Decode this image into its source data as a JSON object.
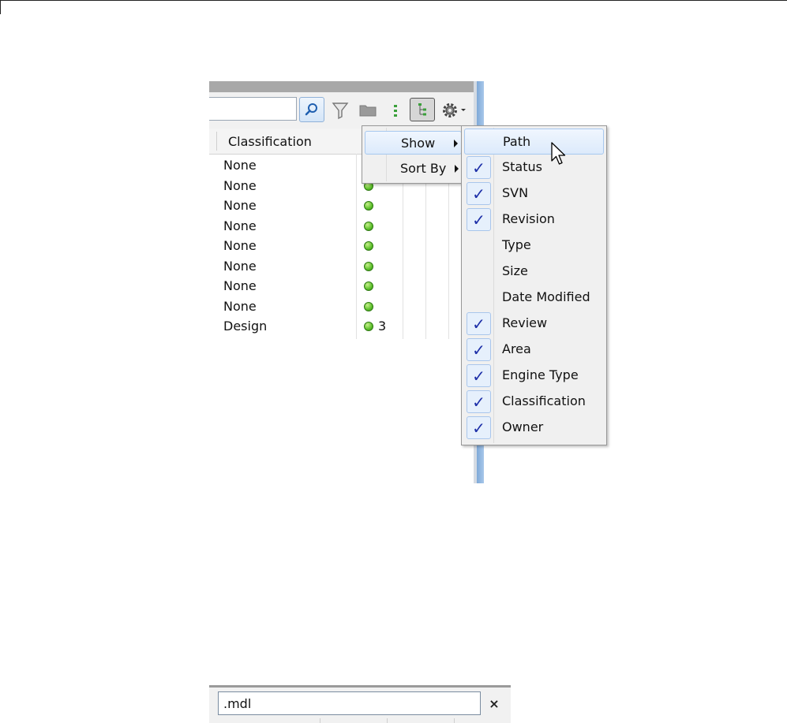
{
  "column_header": "Classification",
  "rows": [
    {
      "classification": "None",
      "status_count": ""
    },
    {
      "classification": "None",
      "status_count": ""
    },
    {
      "classification": "None",
      "status_count": ""
    },
    {
      "classification": "None",
      "status_count": ""
    },
    {
      "classification": "None",
      "status_count": ""
    },
    {
      "classification": "None",
      "status_count": ""
    },
    {
      "classification": "None",
      "status_count": ""
    },
    {
      "classification": "None",
      "status_count": ""
    },
    {
      "classification": "Design",
      "status_count": "3"
    }
  ],
  "context_menu": {
    "items": [
      {
        "label": "Show",
        "has_submenu": true,
        "active": true
      },
      {
        "label": "Sort By",
        "has_submenu": true,
        "active": false
      }
    ]
  },
  "show_submenu": {
    "items": [
      {
        "label": "Path",
        "checked": false,
        "hovered": true
      },
      {
        "label": "Status",
        "checked": true
      },
      {
        "label": "SVN",
        "checked": true
      },
      {
        "label": "Revision",
        "checked": true
      },
      {
        "label": "Type",
        "checked": false
      },
      {
        "label": "Size",
        "checked": false
      },
      {
        "label": "Date Modified",
        "checked": false
      },
      {
        "label": "Review",
        "checked": true
      },
      {
        "label": "Area",
        "checked": true
      },
      {
        "label": "Engine Type",
        "checked": true
      },
      {
        "label": "Classification",
        "checked": true
      },
      {
        "label": "Owner",
        "checked": true
      }
    ]
  },
  "check_glyph": "✓",
  "filter": {
    "value": ".mdl",
    "clear_label": "×"
  },
  "colors": {
    "status_ok": "#5cbf2a",
    "check": "#1d2fa8",
    "menu_highlight": "#dceafb"
  }
}
